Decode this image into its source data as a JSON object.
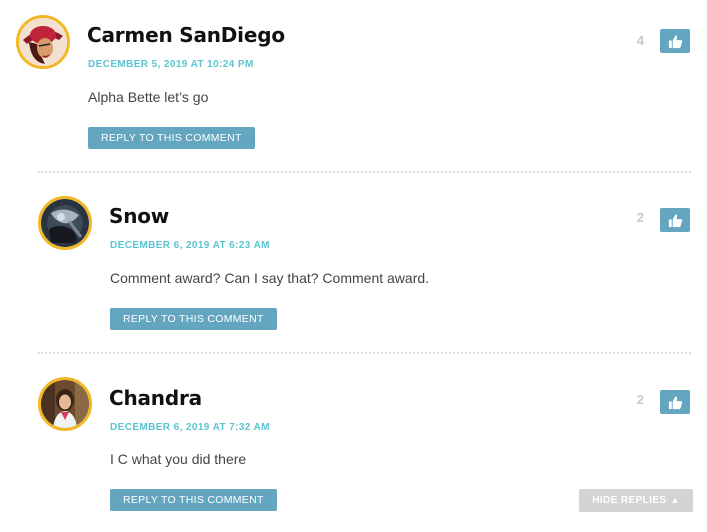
{
  "comments": [
    {
      "author": "Carmen SanDiego",
      "date": "DECEMBER 5, 2019 AT 10:24 PM",
      "text": "Alpha Bette let’s go",
      "reply_label": "REPLY TO THIS COMMENT",
      "likes": "4"
    },
    {
      "author": "Snow",
      "date": "DECEMBER 6, 2019 AT 6:23 AM",
      "text": "Comment award? Can I say that? Comment award.",
      "reply_label": "REPLY TO THIS COMMENT",
      "likes": "2"
    },
    {
      "author": "Chandra",
      "date": "DECEMBER 6, 2019 AT 7:32 AM",
      "text": "I C what you did there",
      "reply_label": "REPLY TO THIS COMMENT",
      "likes": "2"
    }
  ],
  "hide_replies": {
    "label": "HIDE REPLIES",
    "arrow": "▲"
  },
  "icons": {
    "avatar": "user-avatar-icon",
    "like": "thumbs-up-icon"
  },
  "colors": {
    "accent": "#64a6bf",
    "date": "#5bc4d1",
    "avatar_border": "#f2b824",
    "count": "#c8c8c8",
    "hide_button": "#d4d4d4"
  }
}
